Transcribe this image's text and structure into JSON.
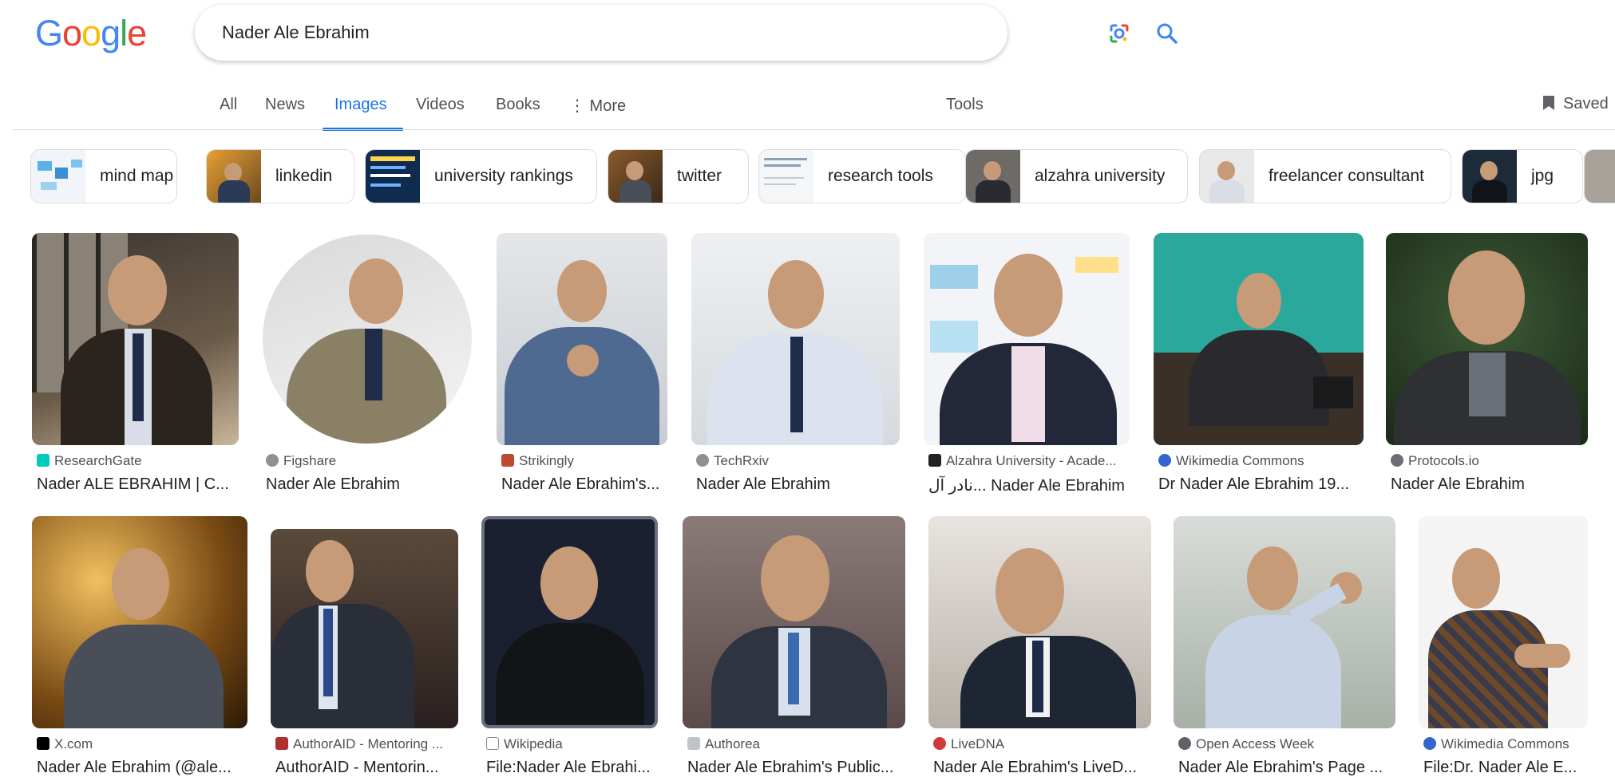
{
  "search": {
    "query": "Nader Ale Ebrahim"
  },
  "tabs": [
    {
      "label": "All"
    },
    {
      "label": "News"
    },
    {
      "label": "Images"
    },
    {
      "label": "Videos"
    },
    {
      "label": "Books"
    },
    {
      "label": "⋮ More"
    }
  ],
  "tools_label": "Tools",
  "saved_label": "Saved",
  "chips": [
    {
      "label": "mind map"
    },
    {
      "label": "linkedin"
    },
    {
      "label": "university rankings"
    },
    {
      "label": "twitter"
    },
    {
      "label": "research tools"
    },
    {
      "label": "alzahra university"
    },
    {
      "label": "freelancer consultant"
    },
    {
      "label": "jpg"
    }
  ],
  "results_row1": [
    {
      "source": "ResearchGate",
      "title": "Nader ALE EBRAHIM | C..."
    },
    {
      "source": "Figshare",
      "title": "Nader Ale Ebrahim"
    },
    {
      "source": "Strikingly",
      "title": "Nader Ale Ebrahim's..."
    },
    {
      "source": "TechRxiv",
      "title": "Nader Ale Ebrahim"
    },
    {
      "source": "Alzahra University - Acade...",
      "title": "نادر آل... Nader Ale Ebrahim"
    },
    {
      "source": "Wikimedia Commons",
      "title": "Dr Nader Ale Ebrahim 19..."
    },
    {
      "source": "Protocols.io",
      "title": "Nader Ale Ebrahim"
    }
  ],
  "results_row2": [
    {
      "source": "X.com",
      "title": "Nader Ale Ebrahim (@ale..."
    },
    {
      "source": "AuthorAID - Mentoring ...",
      "title": "AuthorAID - Mentorin..."
    },
    {
      "source": "Wikipedia",
      "title": "File:Nader Ale Ebrahi..."
    },
    {
      "source": "Authorea",
      "title": "Nader Ale Ebrahim's Public..."
    },
    {
      "source": "LiveDNA",
      "title": "Nader Ale Ebrahim's LiveD..."
    },
    {
      "source": "Open Access Week",
      "title": "Nader Ale Ebrahim's Page ..."
    },
    {
      "source": "Wikimedia Commons",
      "title": "File:Dr. Nader Ale E..."
    }
  ]
}
